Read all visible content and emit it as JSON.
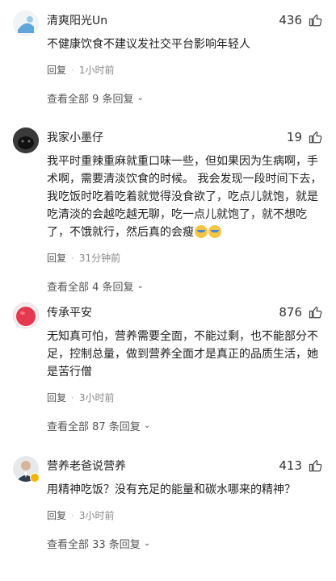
{
  "comments": [
    {
      "user": "清爽阳光Un",
      "likes": "436",
      "text": "不健康饮食不建议发社交平台影响年轻人",
      "reply_label": "回复",
      "time": "1小时前",
      "view_all": "查看全部 9 条回复",
      "avatar_color": "#cfd8dc"
    },
    {
      "user": "我家小墨仔",
      "likes": "19",
      "text": "我平时重辣重麻就重口味一些，但如果因为生病啊，手术啊，需要清淡饮食的时候。 我会发现一段时间下去，我吃饭时吃着吃着就觉得没食欲了，吃点儿就饱，就是吃清淡的会越吃越无聊，吃一点儿就饱了，就不想吃了，不饿就行，然后真的会瘦",
      "reply_label": "回复",
      "time": "31分钟前",
      "view_all": "查看全部 4 条回复",
      "avatar_color": "#222222"
    },
    {
      "user": "传承平安",
      "likes": "876",
      "text": "无知真可怕，营养需要全面，不能过剩，也不能部分不足，控制总量，做到营养全面才是真正的品质生活，她是苦行僧",
      "reply_label": "回复",
      "time": "3小时前",
      "view_all": "查看全部 87 条回复",
      "avatar_color": "#e53950"
    },
    {
      "user": "营养老爸说营养",
      "likes": "413",
      "text": "用精神吃饭？没有充足的能量和碳水哪来的精神？",
      "reply_label": "回复",
      "time": "3小时前",
      "view_all": "查看全部 33 条回复",
      "avatar_color": "#b0bec5"
    }
  ],
  "dot": "·"
}
